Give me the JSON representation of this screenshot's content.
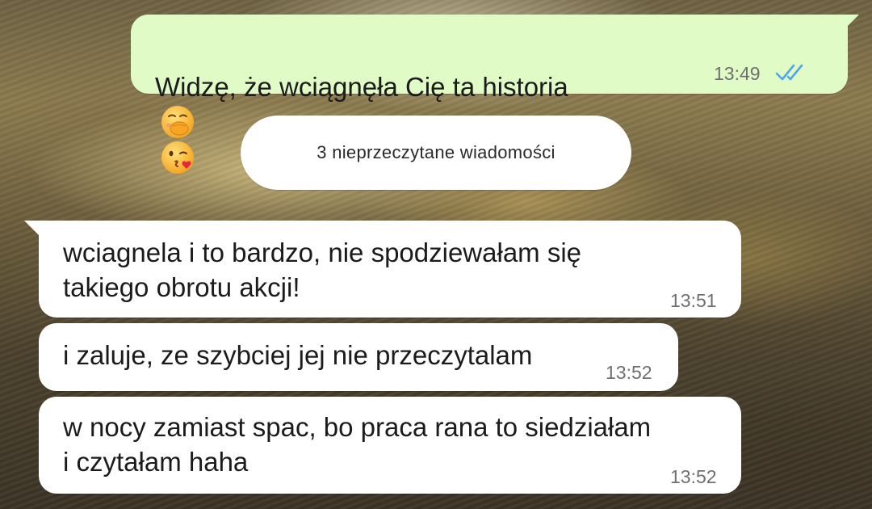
{
  "conversation": {
    "messages": [
      {
        "direction": "outgoing",
        "text": "Widzę, że wciągnęła Cię ta historia",
        "emojis": [
          "face-with-hand-over-mouth-emoji",
          "face-blowing-a-kiss-emoji"
        ],
        "time": "13:49",
        "status": "read",
        "status_icon": "double-check-icon"
      },
      {
        "direction": "incoming",
        "text": "wciagnela i to bardzo, nie spodziewałam się\ntakiego obrotu akcji!",
        "time": "13:51"
      },
      {
        "direction": "incoming",
        "text": "i zaluje, ze szybciej jej nie przeczytalam",
        "time": "13:52"
      },
      {
        "direction": "incoming",
        "text": "w nocy zamiast spac, bo praca rana to siedziałam\ni czytałam haha",
        "time": "13:52"
      }
    ],
    "unread_banner": "3 nieprzeczytane wiadomości"
  },
  "colors": {
    "outgoing_bubble": "#e1fbc6",
    "incoming_bubble": "#ffffff",
    "read_check": "#4fa7e8",
    "timestamp": "#6f6f6f",
    "text": "#1b1b1b"
  }
}
